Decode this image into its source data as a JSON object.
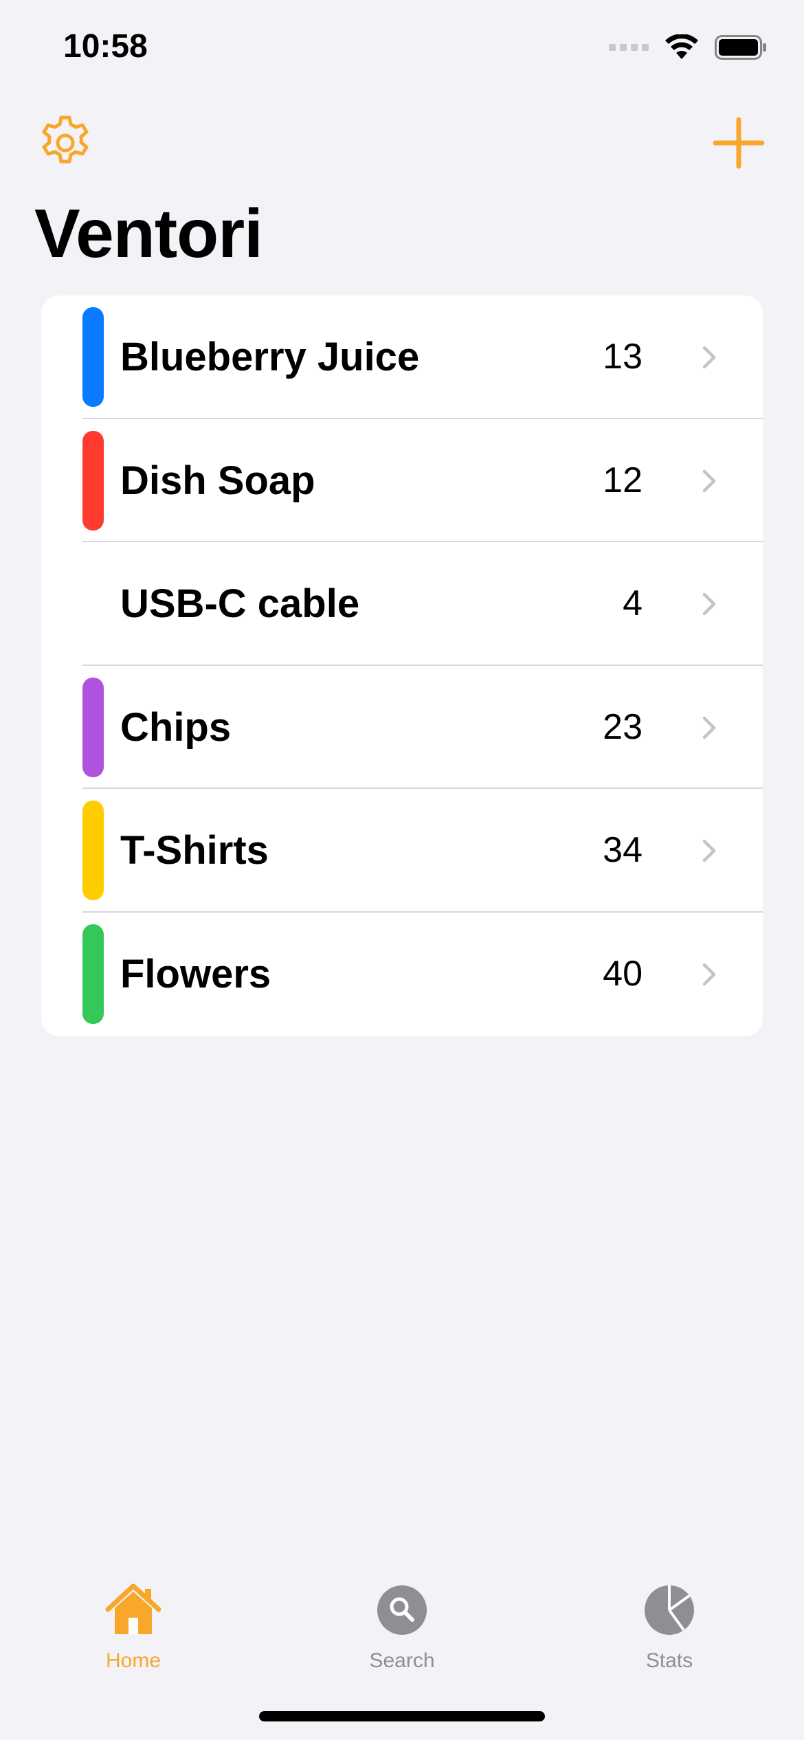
{
  "status_bar": {
    "time": "10:58"
  },
  "nav": {
    "title": "Ventori",
    "settings_icon": "gear-icon",
    "add_icon": "plus-icon"
  },
  "colors": {
    "accent": "#f9a72b",
    "tab_inactive": "#8e8e93",
    "chevron": "#c4c4c7"
  },
  "items": [
    {
      "name": "Blueberry Juice",
      "count": "13",
      "color": "#0a7aff"
    },
    {
      "name": "Dish Soap",
      "count": "12",
      "color": "#ff3b30"
    },
    {
      "name": "USB-C cable",
      "count": "4",
      "color": ""
    },
    {
      "name": "Chips",
      "count": "23",
      "color": "#af52de"
    },
    {
      "name": "T-Shirts",
      "count": "34",
      "color": "#ffcc00"
    },
    {
      "name": "Flowers",
      "count": "40",
      "color": "#34c759"
    }
  ],
  "tabs": [
    {
      "label": "Home",
      "icon": "house-icon",
      "active": true
    },
    {
      "label": "Search",
      "icon": "magnifying-glass-icon",
      "active": false
    },
    {
      "label": "Stats",
      "icon": "pie-chart-icon",
      "active": false
    }
  ]
}
